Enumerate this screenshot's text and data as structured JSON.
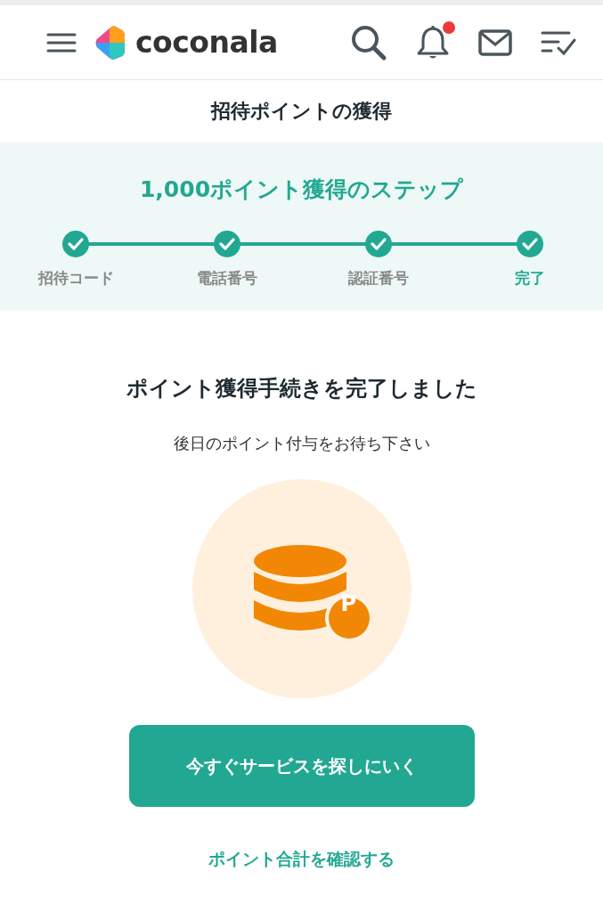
{
  "header": {
    "logo": "coconala",
    "notification_badge": true
  },
  "page_title": "招待ポイントの獲得",
  "steps": {
    "title": "1,000ポイント獲得のステップ",
    "items": [
      {
        "label": "招待コード",
        "done": true,
        "selected": false
      },
      {
        "label": "電話番号",
        "done": true,
        "selected": false
      },
      {
        "label": "認証番号",
        "done": true,
        "selected": false
      },
      {
        "label": "完了",
        "done": true,
        "selected": true
      }
    ]
  },
  "message": {
    "heading": "ポイント獲得手続きを完了しました",
    "text": "後日のポイント付与をお待ち下さい",
    "coin_badge": "P"
  },
  "primary_button": "今すぐサービスを探しにいく",
  "link": "ポイント合計を確認する"
}
